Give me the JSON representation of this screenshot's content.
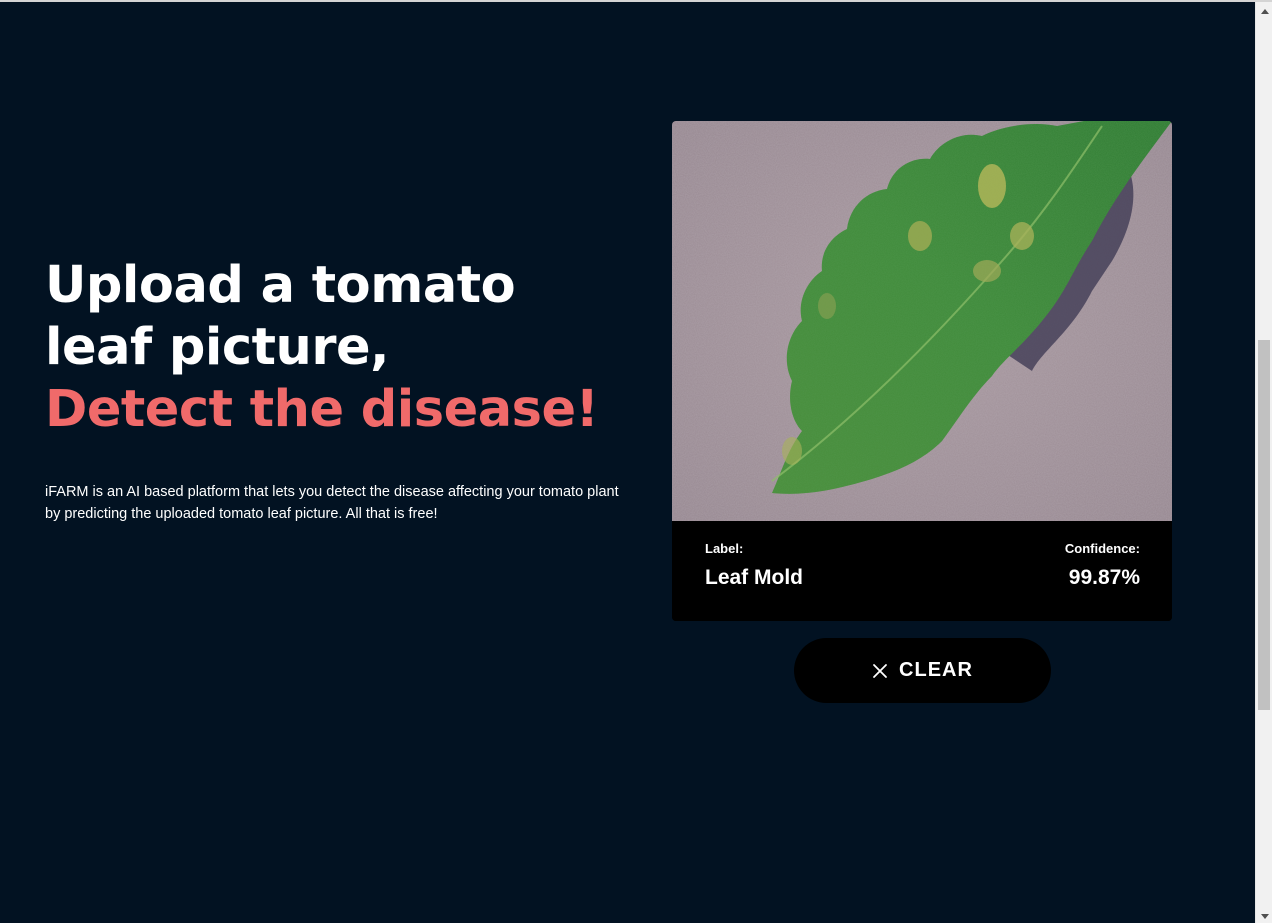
{
  "hero": {
    "headline": "Upload a tomato leaf picture,",
    "headline_accent": "Detect the disease!",
    "description": "iFARM is an AI based platform that lets you detect the disease affecting your tomato plant by predicting the uploaded tomato leaf picture. All that is free!"
  },
  "result": {
    "label_caption": "Label:",
    "label_value": "Leaf Mold",
    "confidence_caption": "Confidence:",
    "confidence_value": "99.87%"
  },
  "actions": {
    "clear_label": "CLEAR",
    "clear_icon": "close-icon"
  },
  "colors": {
    "background": "#021222",
    "accent": "#f06a6a",
    "card": "#000000",
    "text": "#ffffff"
  }
}
